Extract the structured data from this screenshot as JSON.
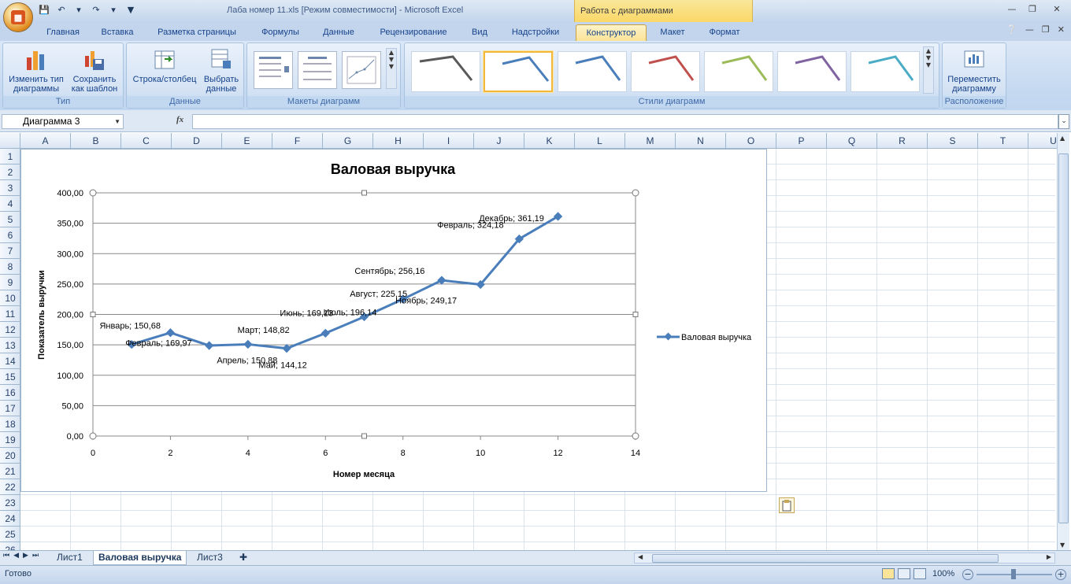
{
  "window": {
    "title": "Лаба номер 11.xls  [Режим совместимости] - Microsoft Excel",
    "context_tab": "Работа с диаграммами"
  },
  "ribbon_tabs": [
    "Главная",
    "Вставка",
    "Разметка страницы",
    "Формулы",
    "Данные",
    "Рецензирование",
    "Вид",
    "Надстройки",
    "Конструктор",
    "Макет",
    "Формат"
  ],
  "ribbon": {
    "groups": {
      "type": "Тип",
      "data": "Данные",
      "layouts": "Макеты диаграмм",
      "styles": "Стили диаграмм",
      "location": "Расположение"
    },
    "buttons": {
      "change_type_1": "Изменить тип",
      "change_type_2": "диаграммы",
      "save_template_1": "Сохранить",
      "save_template_2": "как шаблон",
      "row_col": "Строка/столбец",
      "select_data_1": "Выбрать",
      "select_data_2": "данные",
      "move_chart_1": "Переместить",
      "move_chart_2": "диаграмму"
    },
    "style_colors": [
      "#595959",
      "#4a7ebb",
      "#4a7ebb",
      "#c0504d",
      "#9bbb59",
      "#8064a2",
      "#4bacc6"
    ]
  },
  "formula_bar": {
    "name_box": "Диаграмма 3",
    "fx": "fx",
    "formula": ""
  },
  "columns": [
    "A",
    "B",
    "C",
    "D",
    "E",
    "F",
    "G",
    "H",
    "I",
    "J",
    "K",
    "L",
    "M",
    "N",
    "O",
    "P",
    "Q",
    "R",
    "S",
    "T",
    "U"
  ],
  "rows": [
    "1",
    "2",
    "3",
    "4",
    "5",
    "6",
    "7",
    "8",
    "9",
    "10",
    "11",
    "12",
    "13",
    "14",
    "15",
    "16",
    "17",
    "18",
    "19",
    "20",
    "21",
    "22",
    "23",
    "24",
    "25",
    "26"
  ],
  "sheets": [
    "Лист1",
    "Валовая выручка",
    "Лист3"
  ],
  "status": {
    "ready": "Готово",
    "zoom": "100%"
  },
  "chart_data": {
    "type": "line",
    "title": "Валовая выручка",
    "xlabel": "Номер месяца",
    "ylabel": "Показатель выручки",
    "x": [
      1,
      2,
      3,
      4,
      5,
      6,
      7,
      8,
      9,
      10,
      11,
      12
    ],
    "series": [
      {
        "name": "Валовая выручка",
        "color": "#4a7ebb",
        "values": [
          150.68,
          169.97,
          148.82,
          150.88,
          144.12,
          169.13,
          196.14,
          225.15,
          256.16,
          249.17,
          324.18,
          361.19
        ]
      }
    ],
    "point_labels": [
      "Январь; 150,68",
      "Февраль; 169,97",
      "Март; 148,82",
      "Апрель; 150,88",
      "Май; 144,12",
      "Июнь; 169,13",
      "Июль; 196,14",
      "Август; 225,15",
      "Сентябрь; 256,16",
      "Ноябрь; 249,17",
      "Февраль; 324,18",
      "Декабрь; 361,19"
    ],
    "xlim": [
      0,
      14
    ],
    "xticks": [
      "0",
      "2",
      "4",
      "6",
      "8",
      "10",
      "12",
      "14"
    ],
    "ylim": [
      0,
      400
    ],
    "yticks": [
      "0,00",
      "50,00",
      "100,00",
      "150,00",
      "200,00",
      "250,00",
      "300,00",
      "350,00",
      "400,00"
    ],
    "grid": true,
    "legend": "right"
  }
}
